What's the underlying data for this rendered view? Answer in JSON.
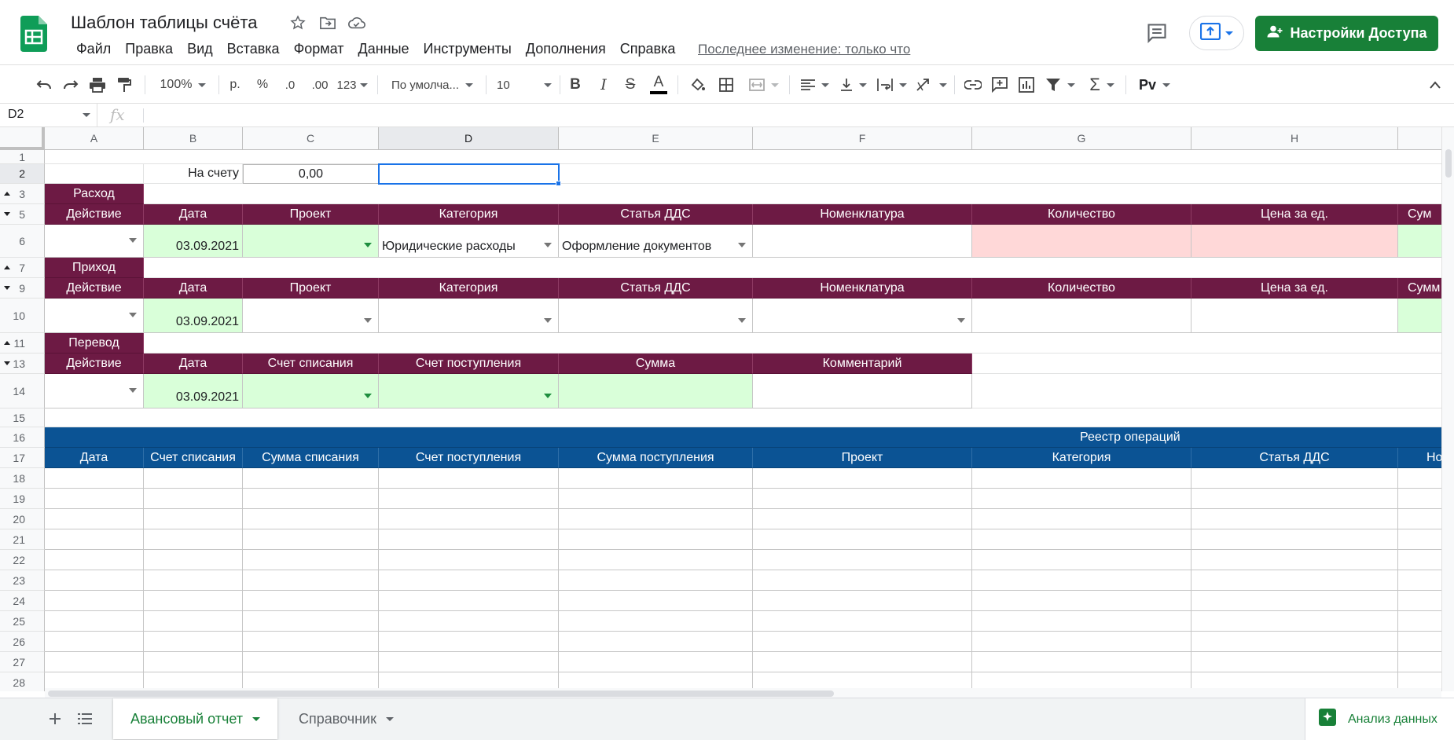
{
  "doc": {
    "title": "Шаблон таблицы счёта",
    "last_edit": "Последнее изменение: только что",
    "share_label": "Настройки Доступа"
  },
  "menu": [
    "Файл",
    "Правка",
    "Вид",
    "Вставка",
    "Формат",
    "Данные",
    "Инструменты",
    "Дополнения",
    "Справка"
  ],
  "toolbar": {
    "zoom": "100%",
    "currency": "р.",
    "percent": "%",
    "dec_less": ".0",
    "dec_more": ".00",
    "more_formats": "123",
    "font": "По умолча...",
    "font_size": "10"
  },
  "formula_bar": {
    "cell_ref": "D2",
    "fx": "fx"
  },
  "columns": [
    "A",
    "B",
    "C",
    "D",
    "E",
    "F",
    "G",
    "H"
  ],
  "rows": [
    "1",
    "2",
    "3",
    "5",
    "6",
    "7",
    "9",
    "10",
    "11",
    "13",
    "14",
    "15",
    "16",
    "17",
    "18",
    "19",
    "20",
    "21",
    "22",
    "23",
    "24",
    "25",
    "26",
    "27",
    "28"
  ],
  "cells": {
    "on_account_label": "На счету",
    "on_account_value": "0,00",
    "expense": {
      "title": "Расход",
      "headers": [
        "Действие",
        "Дата",
        "Проект",
        "Категория",
        "Статья ДДС",
        "Номенклатура",
        "Количество",
        "Цена за ед.",
        "Сум"
      ],
      "date": "03.09.2021",
      "category": "Юридические расходы",
      "article": "Оформление документов"
    },
    "income": {
      "title": "Приход",
      "headers": [
        "Действие",
        "Дата",
        "Проект",
        "Категория",
        "Статья ДДС",
        "Номенклатура",
        "Количество",
        "Цена за ед.",
        "Сумм"
      ],
      "date": "03.09.2021"
    },
    "transfer": {
      "title": "Перевод",
      "headers": [
        "Действие",
        "Дата",
        "Счет списания",
        "Счет поступления",
        "Сумма",
        "Комментарий"
      ],
      "date": "03.09.2021"
    },
    "registry": {
      "title": "Реестр операций",
      "headers": [
        "Дата",
        "Счет списания",
        "Сумма списания",
        "Счет поступления",
        "Сумма поступления",
        "Проект",
        "Категория",
        "Статья ДДС",
        "Но"
      ]
    }
  },
  "sheets": [
    {
      "name": "Авансовый отчет",
      "active": true
    },
    {
      "name": "Справочник",
      "active": false
    }
  ],
  "explore_label": "Анализ данных",
  "colors": {
    "wine": "#6d1a44",
    "blue": "#0b5394",
    "green_fill": "#d9ffd9",
    "pink_fill": "#ffd8d8",
    "brand_green": "#188038",
    "selection": "#1a73e8"
  }
}
